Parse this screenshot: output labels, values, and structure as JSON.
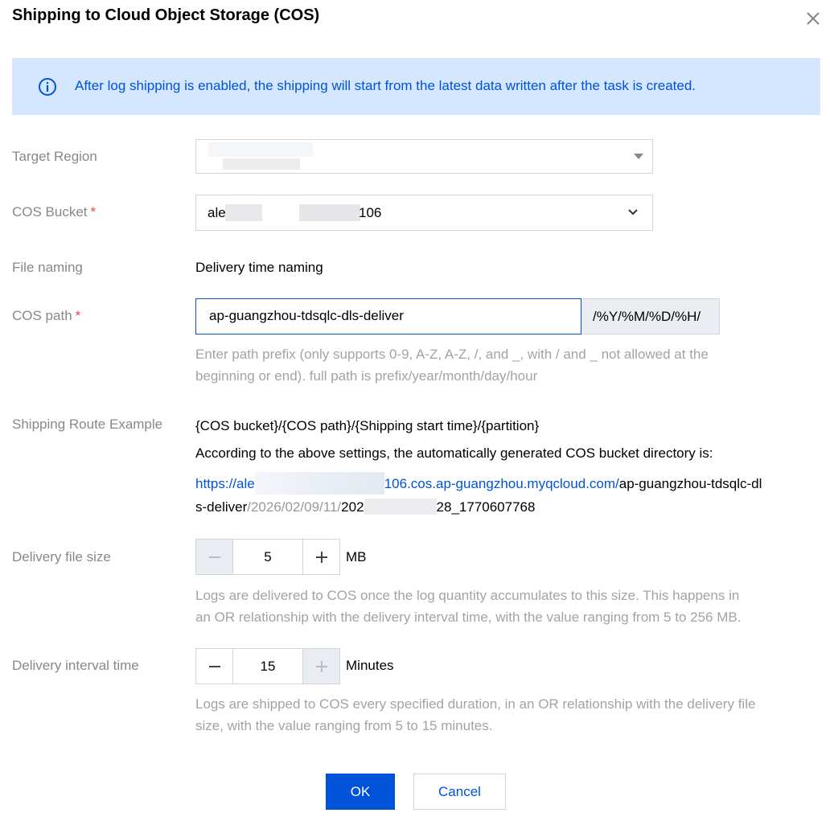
{
  "dialog": {
    "title": "Shipping to Cloud Object Storage (COS)"
  },
  "notice": {
    "text": "After log shipping is enabled, the shipping will start from the latest data written after the task is created."
  },
  "form": {
    "target_region": {
      "label": "Target Region",
      "value": ""
    },
    "cos_bucket": {
      "label": "COS Bucket",
      "required_mark": "*",
      "value_prefix": "ale",
      "value_suffix": "106"
    },
    "file_naming": {
      "label": "File naming",
      "value": "Delivery time naming"
    },
    "cos_path": {
      "label": "COS path",
      "required_mark": "*",
      "value": "ap-guangzhou-tdsqlc-dls-deliver",
      "suffix": "/%Y/%M/%D/%H/",
      "help_line1": "Enter path prefix (only supports 0-9, A-Z, A-Z, /, and _, with / and _ not allowed at the",
      "help_line2": "beginning or end). full path is prefix/year/month/day/hour"
    },
    "route_example": {
      "label": "Shipping Route Example",
      "pattern": "{COS bucket}/{COS path}/{Shipping start time}/{partition}",
      "description": "According to the above settings, the automatically generated COS bucket directory is:",
      "url_start": "https://ale",
      "url_host": "106.cos.ap-guangzhou.myqcloud.com/",
      "path_part1": "ap-guangzhou-tdsqlc-dl",
      "path_part2": "s-deliver",
      "date_part": "/2026/02/09/11/",
      "file_start": "202",
      "file_end": "28_1770607768"
    },
    "file_size": {
      "label": "Delivery file size",
      "value": "5",
      "unit": "MB",
      "help_line1": "Logs are delivered to COS once the log quantity accumulates to this size. This happens in",
      "help_line2": "an OR relationship with the delivery interval time, with the value ranging from 5 to 256 MB."
    },
    "interval": {
      "label": "Delivery interval time",
      "value": "15",
      "unit": "Minutes",
      "help_line1": "Logs are shipped to COS every specified duration, in an OR relationship with the delivery file",
      "help_line2": "size, with the value ranging from 5 to 15 minutes."
    }
  },
  "buttons": {
    "ok": "OK",
    "cancel": "Cancel"
  },
  "colors": {
    "accent": "#0052d9",
    "notice_bg": "#d5e7ff",
    "required": "#e54545"
  }
}
